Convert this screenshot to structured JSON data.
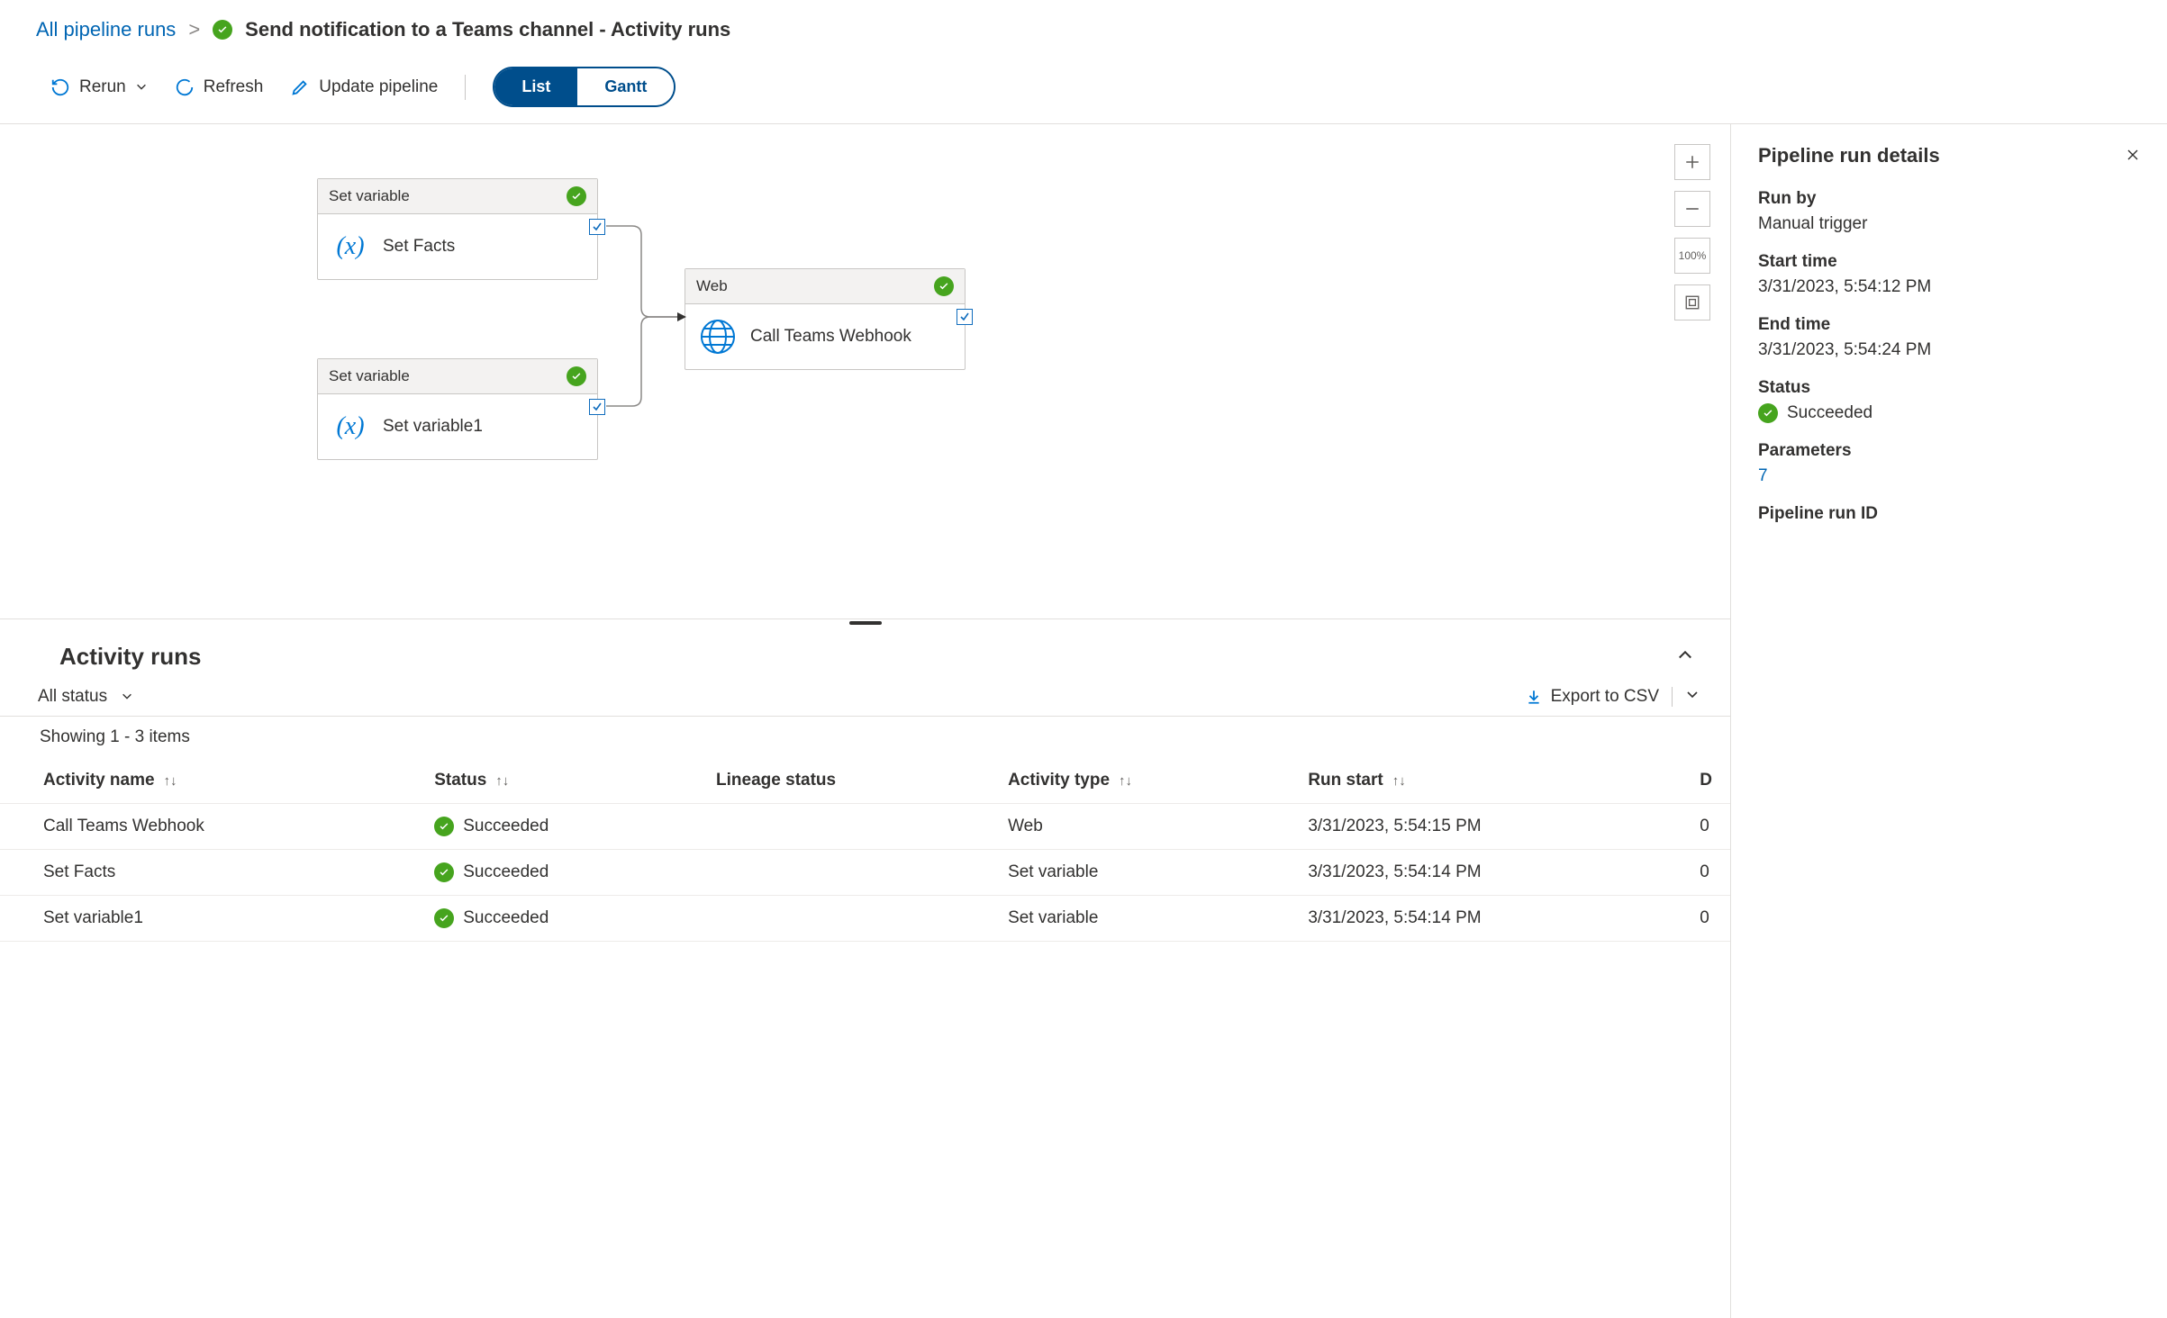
{
  "breadcrumb": {
    "root": "All pipeline runs",
    "title": "Send notification to a Teams channel - Activity runs"
  },
  "toolbar": {
    "rerun": "Rerun",
    "refresh": "Refresh",
    "update": "Update pipeline",
    "list": "List",
    "gantt": "Gantt"
  },
  "canvas": {
    "nodes": [
      {
        "type_label": "Set variable",
        "name": "Set Facts"
      },
      {
        "type_label": "Set variable",
        "name": "Set variable1"
      },
      {
        "type_label": "Web",
        "name": "Call Teams Webhook"
      }
    ],
    "tools": {
      "zoom100": "100%"
    }
  },
  "activity_runs": {
    "heading": "Activity runs",
    "filter_label": "All status",
    "export_label": "Export to CSV",
    "showing": "Showing 1 - 3 items",
    "columns": {
      "activity_name": "Activity name",
      "status": "Status",
      "lineage": "Lineage status",
      "activity_type": "Activity type",
      "run_start": "Run start",
      "last_partial": "D"
    },
    "rows": [
      {
        "name": "Call Teams Webhook",
        "status": "Succeeded",
        "lineage": "",
        "type": "Web",
        "run_start": "3/31/2023, 5:54:15 PM",
        "last": "0"
      },
      {
        "name": "Set Facts",
        "status": "Succeeded",
        "lineage": "",
        "type": "Set variable",
        "run_start": "3/31/2023, 5:54:14 PM",
        "last": "0"
      },
      {
        "name": "Set variable1",
        "status": "Succeeded",
        "lineage": "",
        "type": "Set variable",
        "run_start": "3/31/2023, 5:54:14 PM",
        "last": "0"
      }
    ]
  },
  "details": {
    "heading": "Pipeline run details",
    "run_by_label": "Run by",
    "run_by": "Manual trigger",
    "start_label": "Start time",
    "start": "3/31/2023, 5:54:12 PM",
    "end_label": "End time",
    "end": "3/31/2023, 5:54:24 PM",
    "status_label": "Status",
    "status": "Succeeded",
    "params_label": "Parameters",
    "params": "7",
    "runid_label": "Pipeline run ID"
  }
}
